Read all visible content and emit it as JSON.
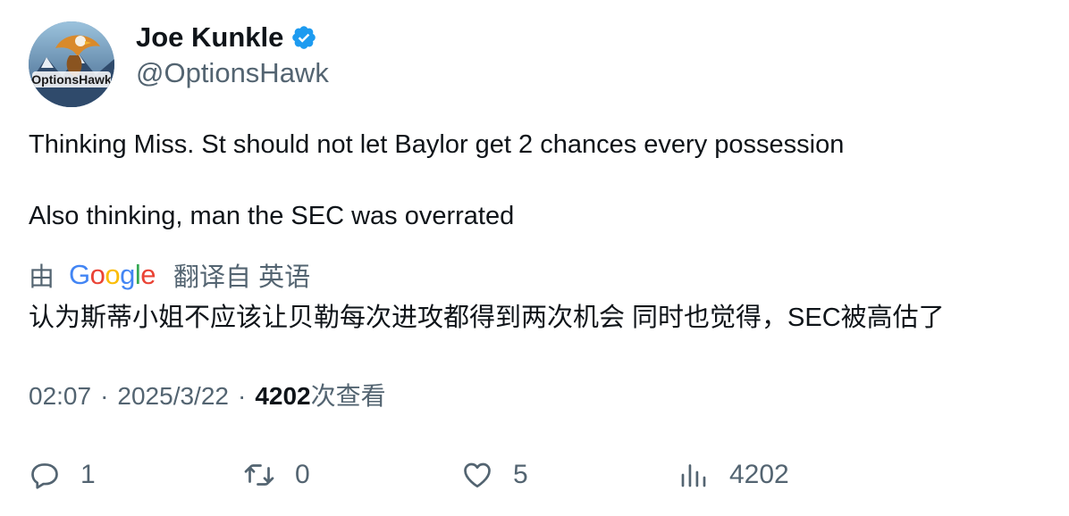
{
  "author": {
    "name": "Joe Kunkle",
    "handle": "@OptionsHawk",
    "avatar_logo_text": "OptionsHawk",
    "verified_icon": "verified-badge-icon",
    "verified_color": "#1d9bf0"
  },
  "tweet": {
    "line1": "Thinking Miss. St should not let Baylor get 2 chances every possession",
    "line2": "Also thinking, man the SEC was overrated"
  },
  "translation": {
    "by_label": "由",
    "provider": "Google",
    "label": "翻译自 英语",
    "text": "认为斯蒂小姐不应该让贝勒每次进攻都得到两次机会 同时也觉得，SEC被高估了"
  },
  "meta": {
    "time": "02:07",
    "sep1": "·",
    "date": "2025/3/22",
    "sep2": "·",
    "views": "4202",
    "views_label": "次查看"
  },
  "actions": {
    "reply_count": "1",
    "retweet_count": "0",
    "like_count": "5",
    "views_count": "4202"
  },
  "colors": {
    "text": "#0f1419",
    "secondary": "#536471",
    "google_blue": "#4285F4",
    "google_red": "#EA4335",
    "google_yellow": "#FBBC05",
    "google_green": "#34A853"
  }
}
